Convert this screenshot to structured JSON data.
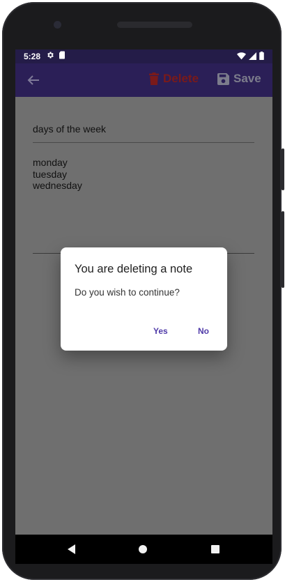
{
  "status_bar": {
    "time": "5:28",
    "icons_left": [
      "gear-icon",
      "sd-card-icon"
    ],
    "icons_right": [
      "wifi-icon",
      "signal-icon",
      "battery-icon"
    ]
  },
  "app_bar": {
    "back_icon": "arrow-back-icon",
    "delete_label": "Delete",
    "delete_icon": "trash-icon",
    "save_label": "Save",
    "save_icon": "floppy-disk-icon",
    "delete_color": "#e53935"
  },
  "note": {
    "title": "days of the week",
    "body": "monday\ntuesday\nwednesday"
  },
  "dialog": {
    "title": "You are deleting a note",
    "message": "Do you wish to continue?",
    "yes_label": "Yes",
    "no_label": "No",
    "accent_color": "#5b3fb4"
  },
  "nav_bar": {
    "icons": [
      "nav-back-icon",
      "nav-home-icon",
      "nav-recents-icon"
    ]
  },
  "colors": {
    "status_bar": "#3a2a73",
    "app_bar": "#4a3595",
    "scrim": "#717171"
  }
}
